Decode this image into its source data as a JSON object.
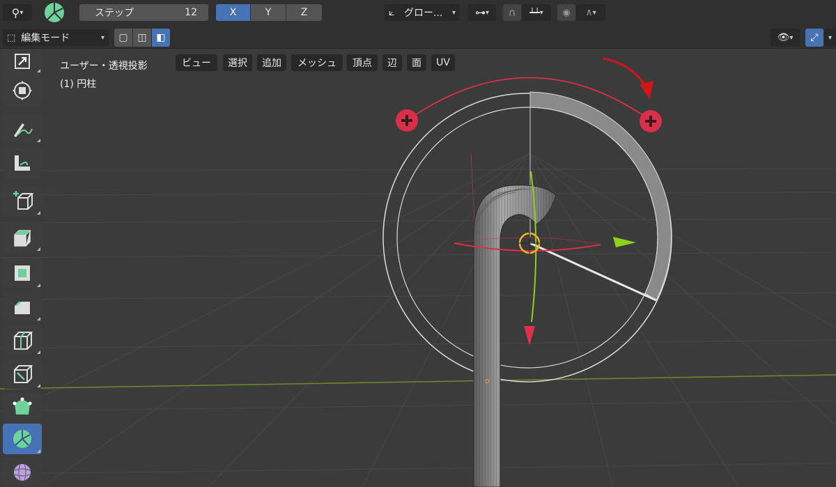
{
  "header": {
    "step_label": "ステップ",
    "step_value": "12",
    "axes": [
      "X",
      "Y",
      "Z"
    ],
    "transform_orientation": "グロー...",
    "mode": "編集モード",
    "menus": [
      "ビュー",
      "選択",
      "追加",
      "メッシュ",
      "頂点",
      "辺",
      "面",
      "UV"
    ]
  },
  "viewport": {
    "view_name": "ユーザー・透視投影",
    "object_name": "(1) 円柱"
  },
  "toolbar": {
    "tools": [
      "scale-cage-icon",
      "transform-icon",
      "annotate-icon",
      "measure-icon",
      "add-cube-icon",
      "extrude-icon",
      "inset-icon",
      "bevel-icon",
      "loop-cut-icon",
      "knife-icon",
      "poly-build-icon",
      "spin-icon",
      "smooth-icon"
    ],
    "active_tool": "spin-icon"
  },
  "colors": {
    "accent": "#4772b3",
    "spin_green": "#6fd29a",
    "gizmo_red": "#d9304a",
    "axis_green": "#8fd11b"
  }
}
